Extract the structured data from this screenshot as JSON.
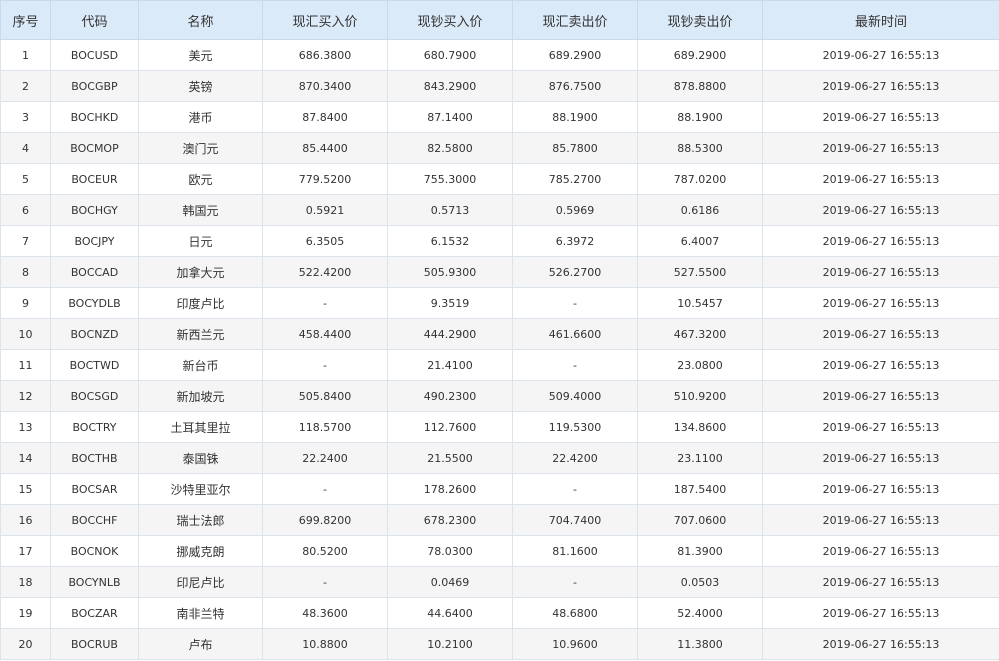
{
  "columns": [
    "序号",
    "代码",
    "名称",
    "现汇买入价",
    "现钞买入价",
    "现汇卖出价",
    "现钞卖出价",
    "最新时间"
  ],
  "rows": [
    [
      "1",
      "BOCUSD",
      "美元",
      "686.3800",
      "680.7900",
      "689.2900",
      "689.2900",
      "2019-06-27 16:55:13"
    ],
    [
      "2",
      "BOCGBP",
      "英镑",
      "870.3400",
      "843.2900",
      "876.7500",
      "878.8800",
      "2019-06-27 16:55:13"
    ],
    [
      "3",
      "BOCHKD",
      "港币",
      "87.8400",
      "87.1400",
      "88.1900",
      "88.1900",
      "2019-06-27 16:55:13"
    ],
    [
      "4",
      "BOCMOP",
      "澳门元",
      "85.4400",
      "82.5800",
      "85.7800",
      "88.5300",
      "2019-06-27 16:55:13"
    ],
    [
      "5",
      "BOCEUR",
      "欧元",
      "779.5200",
      "755.3000",
      "785.2700",
      "787.0200",
      "2019-06-27 16:55:13"
    ],
    [
      "6",
      "BOCHGY",
      "韩国元",
      "0.5921",
      "0.5713",
      "0.5969",
      "0.6186",
      "2019-06-27 16:55:13"
    ],
    [
      "7",
      "BOCJPY",
      "日元",
      "6.3505",
      "6.1532",
      "6.3972",
      "6.4007",
      "2019-06-27 16:55:13"
    ],
    [
      "8",
      "BOCCAD",
      "加拿大元",
      "522.4200",
      "505.9300",
      "526.2700",
      "527.5500",
      "2019-06-27 16:55:13"
    ],
    [
      "9",
      "BOCYDLB",
      "印度卢比",
      "-",
      "9.3519",
      "-",
      "10.5457",
      "2019-06-27 16:55:13"
    ],
    [
      "10",
      "BOCNZD",
      "新西兰元",
      "458.4400",
      "444.2900",
      "461.6600",
      "467.3200",
      "2019-06-27 16:55:13"
    ],
    [
      "11",
      "BOCTWD",
      "新台币",
      "-",
      "21.4100",
      "-",
      "23.0800",
      "2019-06-27 16:55:13"
    ],
    [
      "12",
      "BOCSGD",
      "新加坡元",
      "505.8400",
      "490.2300",
      "509.4000",
      "510.9200",
      "2019-06-27 16:55:13"
    ],
    [
      "13",
      "BOCTRY",
      "土耳其里拉",
      "118.5700",
      "112.7600",
      "119.5300",
      "134.8600",
      "2019-06-27 16:55:13"
    ],
    [
      "14",
      "BOCTHB",
      "泰国铢",
      "22.2400",
      "21.5500",
      "22.4200",
      "23.1100",
      "2019-06-27 16:55:13"
    ],
    [
      "15",
      "BOCSAR",
      "沙特里亚尔",
      "-",
      "178.2600",
      "-",
      "187.5400",
      "2019-06-27 16:55:13"
    ],
    [
      "16",
      "BOCCHF",
      "瑞士法郎",
      "699.8200",
      "678.2300",
      "704.7400",
      "707.0600",
      "2019-06-27 16:55:13"
    ],
    [
      "17",
      "BOCNOK",
      "挪威克朗",
      "80.5200",
      "78.0300",
      "81.1600",
      "81.3900",
      "2019-06-27 16:55:13"
    ],
    [
      "18",
      "BOCYNLB",
      "印尼卢比",
      "-",
      "0.0469",
      "-",
      "0.0503",
      "2019-06-27 16:55:13"
    ],
    [
      "19",
      "BOCZAR",
      "南非兰特",
      "48.3600",
      "44.6400",
      "48.6800",
      "52.4000",
      "2019-06-27 16:55:13"
    ],
    [
      "20",
      "BOCRUB",
      "卢布",
      "10.8800",
      "10.2100",
      "10.9600",
      "11.3800",
      "2019-06-27 16:55:13"
    ]
  ],
  "colors": {
    "header_bg": "#dbeaf8",
    "row_alt_bg": "#f5f5f5",
    "border": "#dde3ea",
    "text": "#333333"
  }
}
